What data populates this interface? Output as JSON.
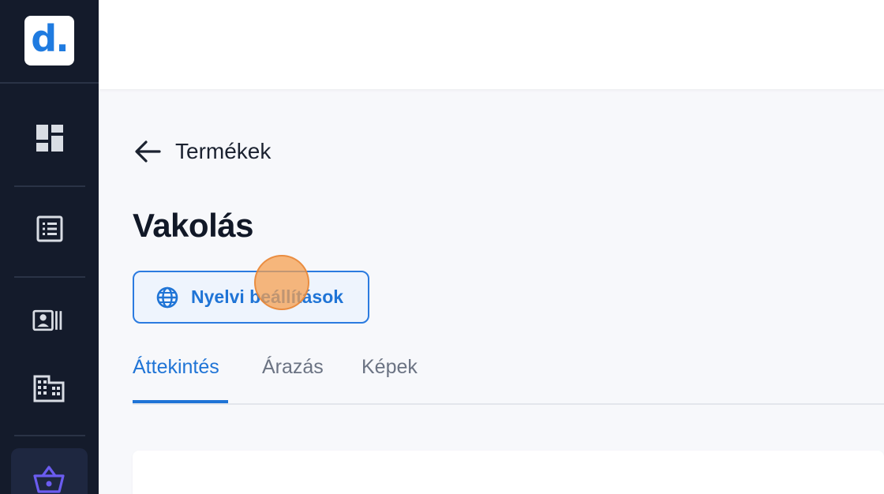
{
  "app": {
    "logo_text": "d.",
    "accent_color": "#1f74d6",
    "sidebar_bg": "#141b2b"
  },
  "sidebar": {
    "items": [
      {
        "icon": "dashboard-icon",
        "active": false
      },
      {
        "icon": "list-icon",
        "active": false
      },
      {
        "icon": "contacts-icon",
        "active": false
      },
      {
        "icon": "building-icon",
        "active": false
      },
      {
        "icon": "basket-icon",
        "active": true
      }
    ]
  },
  "breadcrumb": {
    "back_icon": "arrow-left-icon",
    "label": "Termékek"
  },
  "page": {
    "title": "Vakolás"
  },
  "language_button": {
    "icon": "globe-icon",
    "label": "Nyelvi beállítások"
  },
  "tabs": [
    {
      "label": "Áttekintés",
      "active": true
    },
    {
      "label": "Árazás",
      "active": false
    },
    {
      "label": "Képek",
      "active": false
    }
  ]
}
